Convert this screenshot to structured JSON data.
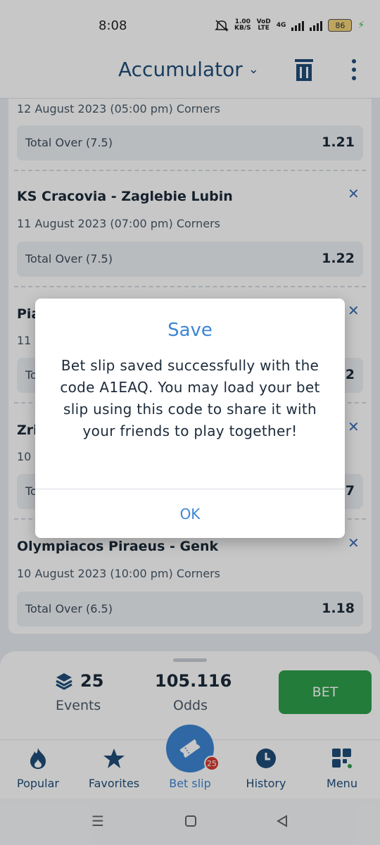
{
  "status_bar": {
    "time": "8:08",
    "speed_value": "1.00",
    "speed_unit": "KB/S",
    "volte_top": "VoD",
    "volte_bottom": "LTE",
    "network": "4G",
    "battery": "86"
  },
  "header": {
    "title": "Accumulator",
    "title_icon": "chevron-down-icon",
    "actions": [
      "trash-icon",
      "more-vert-icon"
    ]
  },
  "bets": [
    {
      "match": "",
      "date": "12 August 2023 (05:00 pm) Corners",
      "market": "Total Over (7.5)",
      "odds": "1.21"
    },
    {
      "match": "KS Cracovia - Zaglebie Lubin",
      "date": "11 August 2023 (07:00 pm) Corners",
      "market": "Total Over (7.5)",
      "odds": "1.22"
    },
    {
      "match": "Pia",
      "date": "11",
      "market": "To",
      "odds": "2"
    },
    {
      "match": "Zri",
      "date": "10",
      "market": "To",
      "odds": "7"
    },
    {
      "match": "Olympiacos Piraeus - Genk",
      "date": "10 August 2023 (10:00 pm) Corners",
      "market": "Total Over (6.5)",
      "odds": "1.18"
    }
  ],
  "summary": {
    "events_count": "25",
    "events_label": "Events",
    "odds_value": "105.116",
    "odds_label": "Odds",
    "bet_label": "BET"
  },
  "bottom_nav": {
    "items": [
      {
        "label": "Popular",
        "icon": "flame-icon"
      },
      {
        "label": "Favorites",
        "icon": "star-icon"
      },
      {
        "label": "Bet slip",
        "icon": "ticket-icon",
        "badge": "25"
      },
      {
        "label": "History",
        "icon": "clock-icon"
      },
      {
        "label": "Menu",
        "icon": "grid-icon"
      }
    ]
  },
  "dialog": {
    "title": "Save",
    "message": "Bet slip saved successfully with the code A1EAQ. You may load your bet slip using this code to share it with your friends to play together!",
    "ok_label": "OK"
  },
  "colors": {
    "accent": "#3d86d4",
    "header_text": "#1f4e79",
    "bet_button": "#2d9f4a",
    "badge": "#d83a2e"
  }
}
